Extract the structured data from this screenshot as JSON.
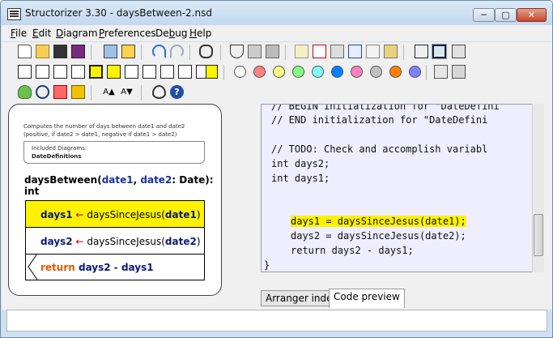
{
  "window": {
    "title": "Structorizer 3.30 - daysBetween-2.nsd",
    "min_label": "─",
    "max_label": "▢",
    "close_label": "✕"
  },
  "menu": [
    {
      "label": "File",
      "key": "F",
      "rest": "ile"
    },
    {
      "label": "Edit",
      "key": "E",
      "rest": "dit"
    },
    {
      "label": "Diagram",
      "key": "D",
      "rest": "iagram"
    },
    {
      "label": "Preferences",
      "key": "P",
      "rest": "references"
    },
    {
      "label": "Debug",
      "key": "b",
      "pre": "De",
      "rest": "ug"
    },
    {
      "label": "Help",
      "key": "H",
      "rest": "elp"
    }
  ],
  "toolbar_colors": [
    "#ffffff",
    "#ff8080",
    "#ffff80",
    "#80ff80",
    "#80ffff",
    "#0080ff",
    "#ff80c0",
    "#c0c0c0",
    "#ff8000",
    "#8080ff"
  ],
  "diagram": {
    "comment_line1": "Computes the number of days between date1 and date2",
    "comment_line2": "(positive, if date2 > date1, negative if date1 > date2)",
    "included_label": "Included Diagrams:",
    "included_value": "DateDefinitions",
    "sig_name": "daysBetween(",
    "sig_p1": "date1",
    "sig_comma": ", ",
    "sig_p2": "date2",
    "sig_rest": ": Date): int",
    "s1_var": "days1",
    "s1_arrow": " ← ",
    "s1_call": "daysSinceJesus(",
    "s1_arg": "date1",
    "s1_close": ")",
    "s2_var": "days2",
    "s2_arrow": " ← ",
    "s2_call": "daysSinceJesus(",
    "s2_arg": "date2",
    "s2_close": ")",
    "s3_kw": "return ",
    "s3_expr": "days2 - days1"
  },
  "code_lines": [
    "// BEGIN initialization for \"DateDefini",
    "// END initialization for \"DateDefini",
    "",
    "// TODO: Check and accomplish variabl",
    "int days2;",
    "int days1;",
    "",
    "",
    "days1 = daysSinceJesus(date1);",
    "days2 = daysSinceJesus(date2);",
    "return days2 - days1;",
    "}"
  ],
  "tabs": {
    "arranger": "Arranger index",
    "preview": "Code preview"
  }
}
